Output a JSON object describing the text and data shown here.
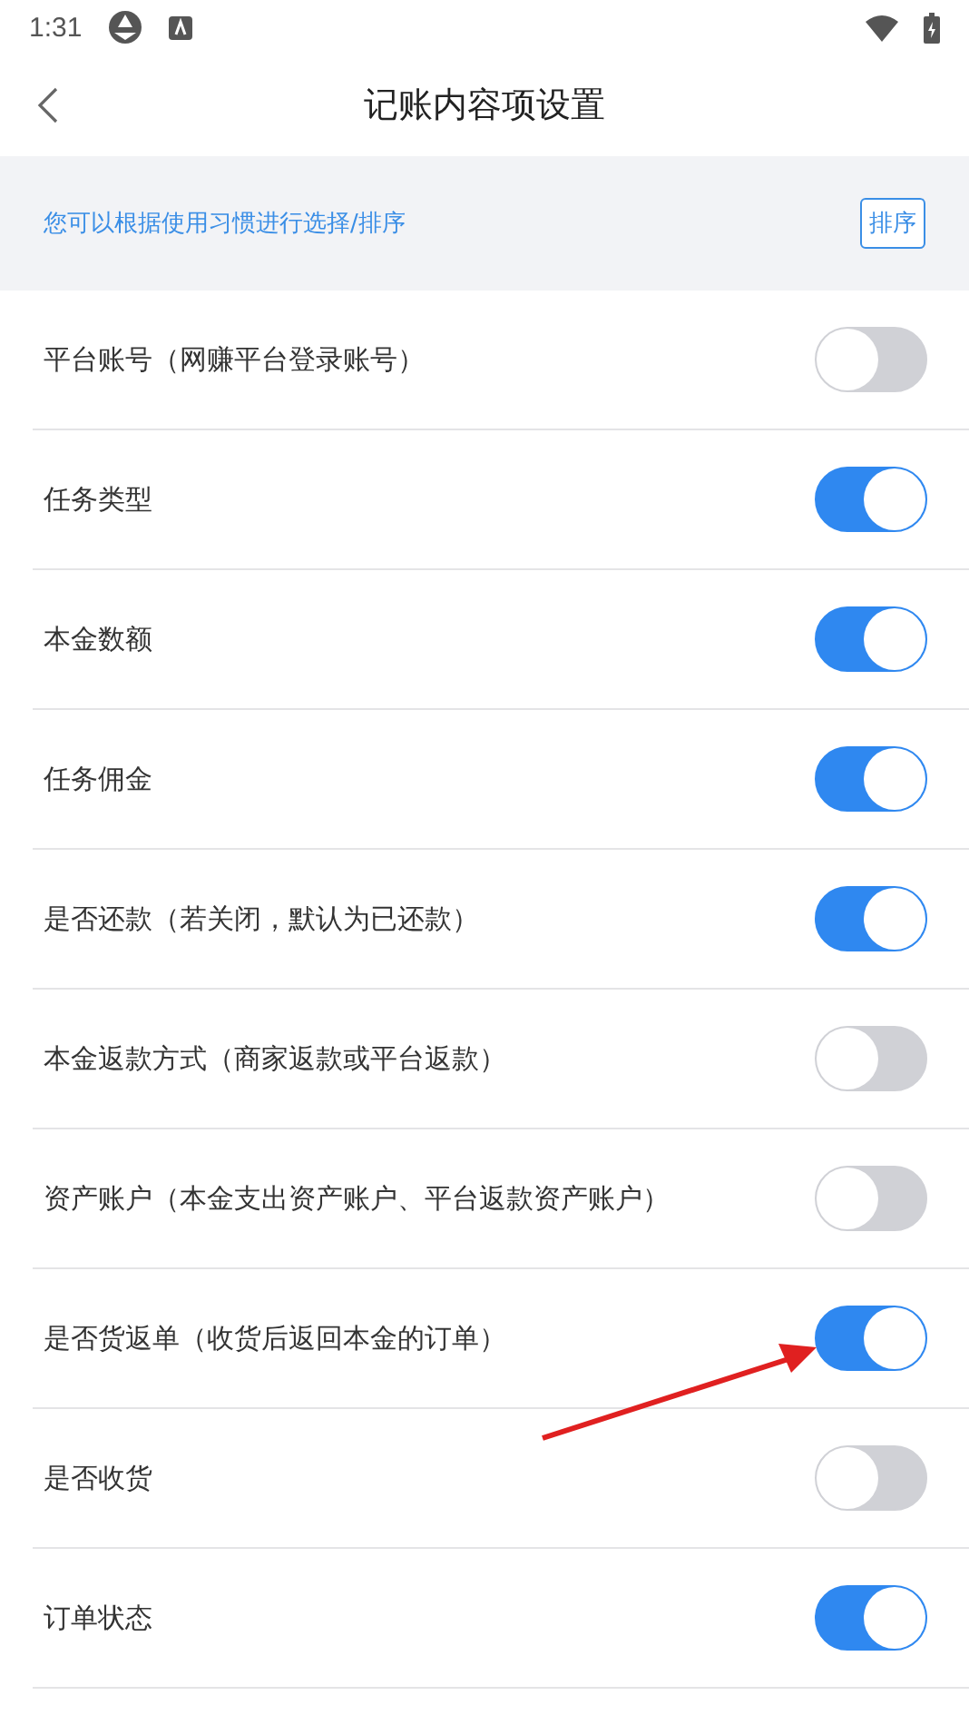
{
  "status_bar": {
    "time": "1:31"
  },
  "header": {
    "title": "记账内容项设置"
  },
  "banner": {
    "hint": "您可以根据使用习惯进行选择/排序",
    "button": "排序"
  },
  "items": [
    {
      "label": "平台账号（网赚平台登录账号）",
      "on": false
    },
    {
      "label": "任务类型",
      "on": true
    },
    {
      "label": "本金数额",
      "on": true
    },
    {
      "label": "任务佣金",
      "on": true
    },
    {
      "label": "是否还款（若关闭，默认为已还款）",
      "on": true
    },
    {
      "label": "本金返款方式（商家返款或平台返款）",
      "on": false
    },
    {
      "label": "资产账户（本金支出资产账户、平台返款资产账户）",
      "on": false
    },
    {
      "label": "是否货返单（收货后返回本金的订单）",
      "on": true
    },
    {
      "label": "是否收货",
      "on": false
    },
    {
      "label": "订单状态",
      "on": true
    }
  ]
}
